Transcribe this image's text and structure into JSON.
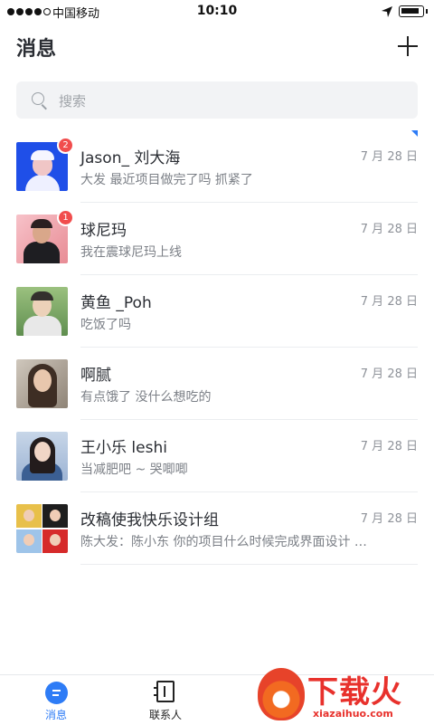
{
  "status_bar": {
    "carrier": "中国移动",
    "time": "10:10"
  },
  "header": {
    "title": "消息"
  },
  "search": {
    "placeholder": "搜索"
  },
  "conversations": [
    {
      "name": "Jason_ 刘大海",
      "message": "大发 最近项目做完了吗 抓紧了",
      "date": "7 月 28 日",
      "badge": "2",
      "pinned": true
    },
    {
      "name": "球尼玛",
      "message": "我在震球尼玛上线",
      "date": "7 月 28 日",
      "badge": "1"
    },
    {
      "name": "黄鱼 _Poh",
      "message": "吃饭了吗",
      "date": "7 月 28 日"
    },
    {
      "name": "啊腻",
      "message": "有点饿了 没什么想吃的",
      "date": "7 月 28 日"
    },
    {
      "name": "王小乐 leshi",
      "message": "当减肥吧 ~ 哭唧唧",
      "date": "7 月 28 日"
    },
    {
      "name": "改稿使我快乐设计组",
      "message": "陈大发：陈小东 你的项目什么时候完成界面设计 …",
      "date": "7 月 28 日"
    }
  ],
  "tabbar": {
    "messages": "消息",
    "contacts": "联系人",
    "third": ""
  },
  "watermark": {
    "brand": "下载火",
    "url": "xiazaihuo.com"
  },
  "colors": {
    "accent": "#2e7cf6",
    "badge": "#f14d4d",
    "watermark": "#e8312c"
  }
}
